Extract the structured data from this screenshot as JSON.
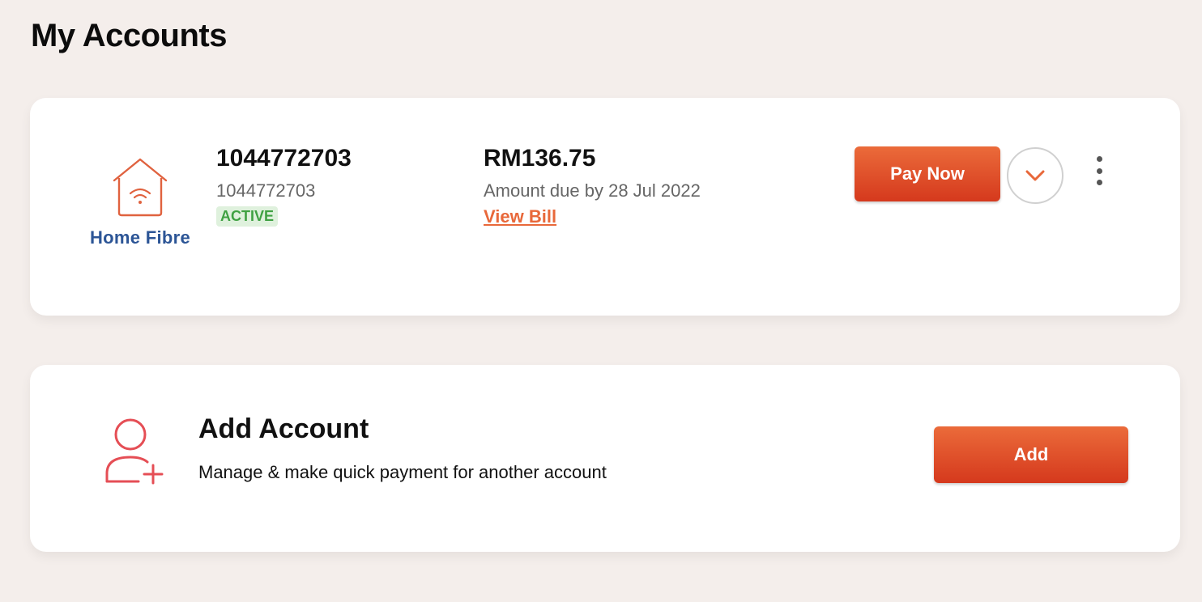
{
  "page": {
    "title": "My Accounts"
  },
  "account": {
    "service_label": "Home Fibre",
    "service_icon": "home-wifi-icon",
    "account_number": "1044772703",
    "account_sub": "1044772703",
    "status": "ACTIVE",
    "amount": "RM136.75",
    "due_text": "Amount due by 28 Jul 2022",
    "view_bill_label": "View Bill",
    "pay_label": "Pay Now",
    "expand_icon": "chevron-down-icon",
    "more_icon": "kebab-menu-icon"
  },
  "add_account": {
    "icon": "add-user-icon",
    "title": "Add Account",
    "description": "Manage & make quick payment for another account",
    "button_label": "Add"
  },
  "colors": {
    "accent": "#e8683a",
    "button_top": "#eb6b3a",
    "button_bottom": "#d5391d",
    "service_label": "#2c5596",
    "active_badge_bg": "#dff1dd",
    "active_badge_text": "#3fa142",
    "background": "#f4eeeb"
  }
}
